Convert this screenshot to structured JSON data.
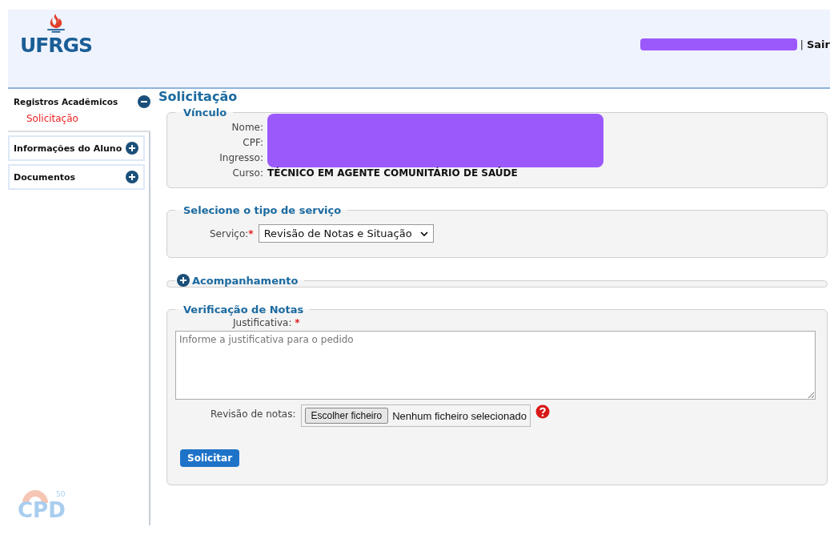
{
  "header": {
    "logo": "UFRGS",
    "logout": "Sair",
    "separator": "|"
  },
  "sidebar": [
    {
      "label": "Registros Acadêmicos",
      "expanded": true,
      "children": [
        {
          "label": "Solicitação",
          "selected": true
        }
      ]
    },
    {
      "label": "Informações do Aluno",
      "expanded": false
    },
    {
      "label": "Documentos",
      "expanded": false
    }
  ],
  "footer_logo": {
    "text": "CPD",
    "badge": "50"
  },
  "page_title": "Solicitação",
  "vinculo": {
    "legend": "Vínculo",
    "fields": [
      {
        "label": "Nome:",
        "redacted": true
      },
      {
        "label": "CPF:",
        "redacted": true
      },
      {
        "label": "Ingresso:",
        "redacted": true
      },
      {
        "label": "Curso:",
        "value": "TÉCNICO EM AGENTE COMUNITÁRIO DE SAÚDE",
        "redacted": false
      }
    ]
  },
  "servico": {
    "legend": "Selecione o tipo de serviço",
    "label": "Serviço:",
    "required_mark": "*",
    "value": "Revisão de Notas e Situação"
  },
  "acompanhamento": {
    "legend": "Acompanhamento",
    "expanded": false
  },
  "verificacao": {
    "legend": "Verificação de Notas",
    "justificativa_label": "Justificativa:",
    "required_mark": "*",
    "placeholder": "Informe a justificativa para o pedido",
    "file_label": "Revisão de notas:",
    "file_button": "Escolher ficheiro",
    "file_status": "Nenhum ficheiro selecionado",
    "submit": "Solicitar"
  }
}
